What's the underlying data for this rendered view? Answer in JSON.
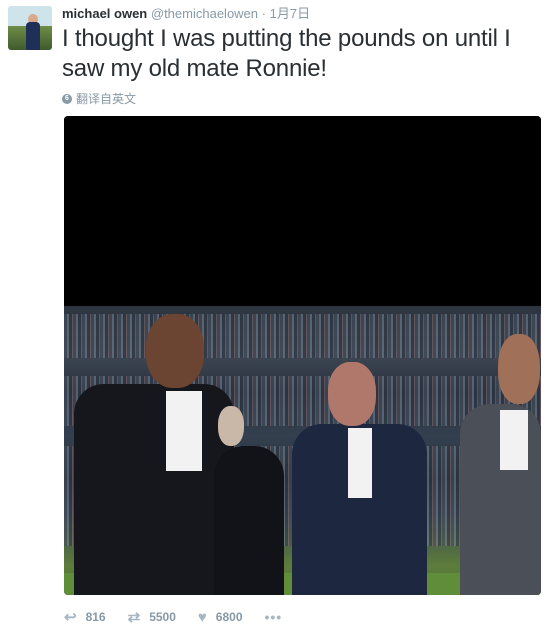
{
  "tweet": {
    "author_name": "michael owen",
    "author_handle": "@themichaelowen",
    "separator": "·",
    "date": "1月7日",
    "text": "I thought I was putting the pounds on until I saw my old mate Ronnie!",
    "translate_label": "翻译自英文"
  },
  "actions": {
    "reply_icon": "reply-icon",
    "reply_count": "816",
    "retweet_icon": "retweet-icon",
    "retweet_count": "5500",
    "like_icon": "heart-icon",
    "like_count": "6800",
    "more_icon": "more-icon",
    "more_label": "•••"
  },
  "colors": {
    "text": "#292f33",
    "muted": "#8899a6",
    "background": "#ffffff"
  }
}
